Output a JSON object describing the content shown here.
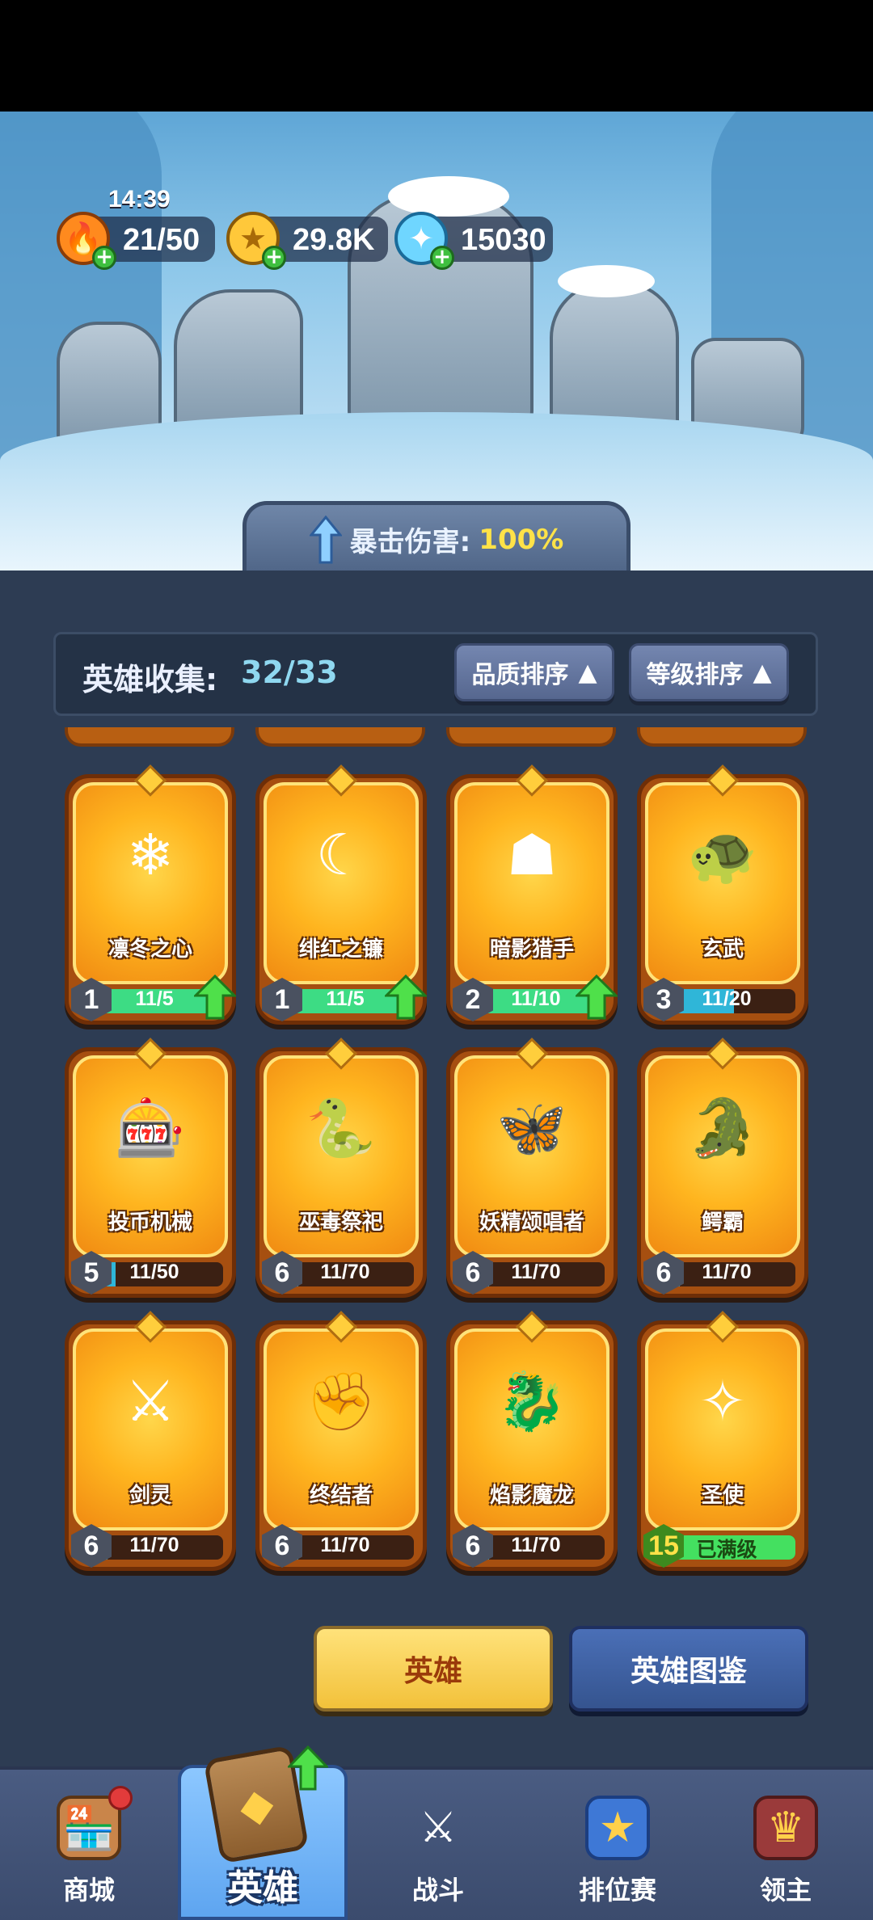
{
  "status": {
    "clock": "14:39"
  },
  "resources": {
    "energy": "21/50",
    "gold": "29.8K",
    "gems": "15030"
  },
  "banner": {
    "crit_label": "暴击伤害:",
    "crit_value": "100%"
  },
  "collection": {
    "label": "英雄收集:",
    "value": "32/33",
    "sort_quality": "品质排序",
    "sort_level": "等级排序"
  },
  "heroes": [
    {
      "name": "凛冬之心",
      "level": "1",
      "count": "11/5",
      "progress": 1.0,
      "upgradable": true,
      "icon": "ice-mage-icon"
    },
    {
      "name": "绯红之镰",
      "level": "1",
      "count": "11/5",
      "progress": 1.0,
      "upgradable": true,
      "icon": "scythe-demon-icon"
    },
    {
      "name": "暗影猎手",
      "level": "2",
      "count": "11/10",
      "progress": 1.0,
      "upgradable": true,
      "icon": "shadow-hunter-icon"
    },
    {
      "name": "玄武",
      "level": "3",
      "count": "11/20",
      "progress": 0.55,
      "upgradable": false,
      "icon": "turtle-icon"
    },
    {
      "name": "投币机械",
      "level": "5",
      "count": "11/50",
      "progress": 0.22,
      "upgradable": false,
      "icon": "slot-machine-icon"
    },
    {
      "name": "巫毒祭祀",
      "level": "6",
      "count": "11/70",
      "progress": 0.16,
      "upgradable": false,
      "icon": "voodoo-priestess-icon"
    },
    {
      "name": "妖精颂唱者",
      "level": "6",
      "count": "11/70",
      "progress": 0.16,
      "upgradable": false,
      "icon": "fairy-singer-icon"
    },
    {
      "name": "鳄霸",
      "level": "6",
      "count": "11/70",
      "progress": 0.16,
      "upgradable": false,
      "icon": "crocodile-icon"
    },
    {
      "name": "剑灵",
      "level": "6",
      "count": "11/70",
      "progress": 0.16,
      "upgradable": false,
      "icon": "sword-spirit-icon"
    },
    {
      "name": "终结者",
      "level": "6",
      "count": "11/70",
      "progress": 0.16,
      "upgradable": false,
      "icon": "terminator-icon"
    },
    {
      "name": "焰影魔龙",
      "level": "6",
      "count": "11/70",
      "progress": 0.16,
      "upgradable": false,
      "icon": "dragon-icon"
    },
    {
      "name": "圣使",
      "level": "15",
      "count": "已满级",
      "progress": 1.0,
      "upgradable": false,
      "icon": "angel-icon"
    }
  ],
  "buttons": {
    "hero": "英雄",
    "codex": "英雄图鉴"
  },
  "nav": {
    "shop": "商城",
    "hero": "英雄",
    "battle": "战斗",
    "ranked": "排位赛",
    "lord": "领主"
  },
  "colors": {
    "progress_green": "#3ddc84",
    "progress_blue": "#2fb6d8",
    "progress_max": "#44e060",
    "card_orange": "#ffb51f"
  }
}
